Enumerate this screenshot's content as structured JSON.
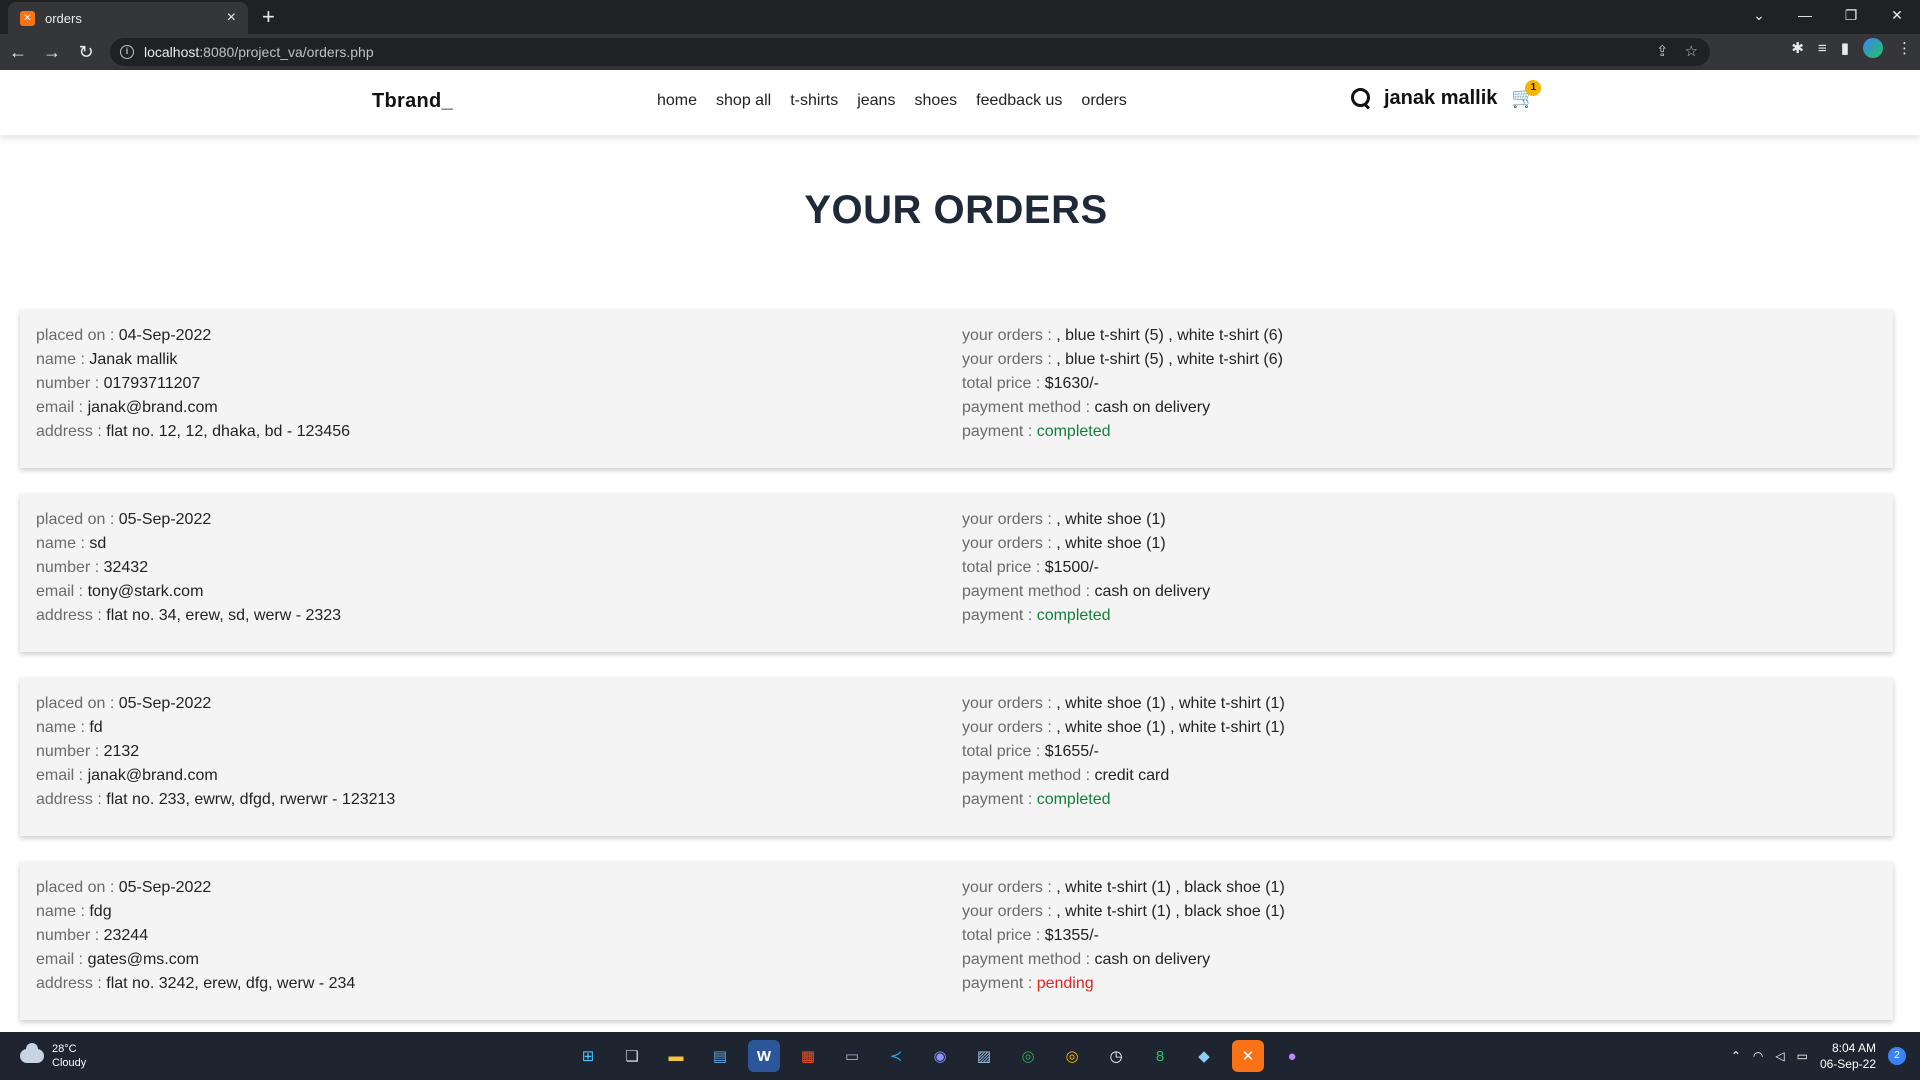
{
  "browser": {
    "tab_title": "orders",
    "new_tab": "+",
    "url_host": "localhost",
    "url_path": ":8080/project_va/orders.php"
  },
  "site": {
    "logo": "Tbrand_",
    "nav": [
      "home",
      "shop all",
      "t-shirts",
      "jeans",
      "shoes",
      "feedback us",
      "orders"
    ],
    "username": "janak mallik",
    "cart_count": "1"
  },
  "page": {
    "title": "YOUR ORDERS"
  },
  "labels": {
    "placed_on": "placed on : ",
    "name": "name : ",
    "number": "number : ",
    "email": "email : ",
    "address": "address : ",
    "your_orders": "your orders : ",
    "total_price": "total price : ",
    "payment_method": "payment method : ",
    "payment": "payment : "
  },
  "orders": [
    {
      "placed_on": "04-Sep-2022",
      "name": "Janak mallik",
      "number": "01793711207",
      "email": "janak@brand.com",
      "address": "flat no. 12, 12, dhaka, bd - 123456",
      "your_orders": ", blue t-shirt (5) , white t-shirt (6)",
      "total_price": "$1630/-",
      "payment_method": "cash on delivery",
      "payment": "completed"
    },
    {
      "placed_on": "05-Sep-2022",
      "name": "sd",
      "number": "32432",
      "email": "tony@stark.com",
      "address": "flat no. 34, erew, sd, werw - 2323",
      "your_orders": ", white shoe (1)",
      "total_price": "$1500/-",
      "payment_method": "cash on delivery",
      "payment": "completed"
    },
    {
      "placed_on": "05-Sep-2022",
      "name": "fd",
      "number": "2132",
      "email": "janak@brand.com",
      "address": "flat no. 233, ewrw, dfgd, rwerwr - 123213",
      "your_orders": ", white shoe (1) , white t-shirt (1)",
      "total_price": "$1655/-",
      "payment_method": "credit card",
      "payment": "completed"
    },
    {
      "placed_on": "05-Sep-2022",
      "name": "fdg",
      "number": "23244",
      "email": "gates@ms.com",
      "address": "flat no. 3242, erew, dfg, werw - 234",
      "your_orders": ", white t-shirt (1) , black shoe (1)",
      "total_price": "$1355/-",
      "payment_method": "cash on delivery",
      "payment": "pending"
    }
  ],
  "colors": {
    "completed": "#15803d",
    "pending": "#dc2626"
  },
  "taskbar": {
    "weather_temp": "28°C",
    "weather_desc": "Cloudy",
    "time": "8:04 AM",
    "date": "06-Sep-22",
    "notifications": "2",
    "apps": [
      "windows-start-icon",
      "task-view-icon",
      "file-explorer-icon",
      "notepad-icon",
      "word-icon",
      "store-icon",
      "remote-desktop-icon",
      "vscode-icon",
      "discord-icon",
      "photos-icon",
      "chrome-icon",
      "chrome-alt-icon",
      "clock-icon",
      "terminal-icon",
      "box-icon",
      "xampp-icon",
      "github-icon"
    ]
  }
}
